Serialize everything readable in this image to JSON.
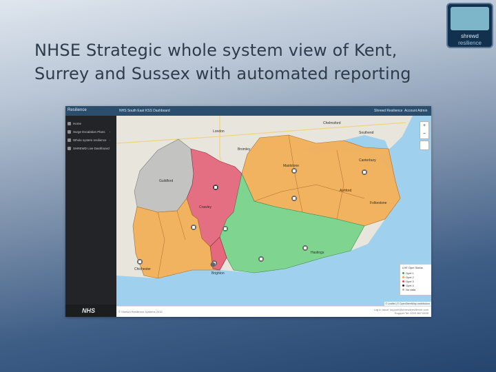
{
  "slide": {
    "title_line1": "NHSE Strategic whole system view of Kent,",
    "title_line2": "Surrey and Sussex with automated reporting",
    "logo_line1": "shrewd",
    "logo_line2": "resilience"
  },
  "app": {
    "name": "Resilience",
    "dashboard_title": "NHS South East KSS Dashboard",
    "top_links": [
      "Shrewd Resilience",
      "Account Admin"
    ],
    "sidebar": [
      {
        "label": "Home",
        "icon": "home-icon",
        "chevron": false
      },
      {
        "label": "Surge Escalation Plans",
        "icon": "document-icon",
        "chevron": true
      },
      {
        "label": "Whole system resilience",
        "icon": "globe-icon",
        "chevron": true
      },
      {
        "label": "SHREWD Live Dashboard",
        "icon": "dashboard-icon",
        "chevron": false
      }
    ],
    "brand_footer": "NHS"
  },
  "map": {
    "labels": {
      "london": "London",
      "bromley": "Bromley",
      "chelmsford": "Chelmsford",
      "southend": "Southend",
      "maidstone": "Maidstone",
      "ashford": "Ashford",
      "brighton": "Brighton",
      "hastings": "Hastings",
      "chichester": "Chichester",
      "crawley": "Crawley",
      "guildford": "Guildford",
      "canterbury": "Canterbury",
      "folkestone": "Folkestone"
    },
    "zoom_in": "+",
    "zoom_out": "−",
    "legend": {
      "title": "LHE Opel Status",
      "items": [
        {
          "label": "Opel 1",
          "color": "#3aa84f"
        },
        {
          "label": "Opel 2",
          "color": "#f0a83c"
        },
        {
          "label": "Opel 3",
          "color": "#e64a5f"
        },
        {
          "label": "Opel 4",
          "color": "#222222"
        },
        {
          "label": "No data",
          "color": "#b3b3b3"
        }
      ]
    },
    "attribution": "© Leaflet | © OpenStreetMap contributors",
    "region_colors": {
      "green": "#79d38a",
      "amber": "#f2b05a",
      "red": "#e5687c",
      "grey": "#bfbfbf",
      "sea": "#9fd1ee"
    }
  },
  "footer": {
    "copyright": "© Shrewd Resilience Systems 2019",
    "support_line1": "Log in issue: support@shrewdresilience.com",
    "support_line2": "Support Tel: 0203 867 6439"
  }
}
